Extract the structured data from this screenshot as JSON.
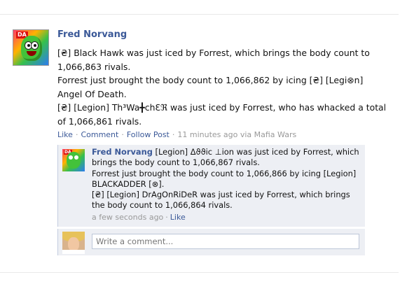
{
  "post": {
    "author": "Fred Norvang",
    "avatar_tag": "DA",
    "lines": [
      "[₴] Black Hawk was just iced by Forrest, which brings the body count to 1,066,863 rivals.",
      "Forrest just brought the body count to 1,066,862 by icing [₴] [Legi⊗n] Angel Of Death.",
      "[₴] [Legion] Th³Wa╋chƐℜ was just iced by Forrest, who has whacked a total of 1,066,861 rivals."
    ],
    "actions": {
      "like": "Like",
      "comment": "Comment",
      "follow": "Follow Post",
      "time": "11 minutes ago via Mafia Wars"
    }
  },
  "comment": {
    "author": "Fred Norvang",
    "avatar_tag": "DA",
    "line1": "[Legion] Δϑϑic ⊥ion was just iced by Forrest, which brings the body count to 1,066,867 rivals.",
    "line2": "Forrest just brought the body count to 1,066,866 by icing [Legion] BLACKADDER [⊗].",
    "line3": "[₴] [Legion] DrAgOnRiDeR was just iced by Forrest, which brings the body count to 1,066,864 rivals.",
    "time": "a few seconds ago",
    "like": "Like"
  },
  "write_comment": {
    "placeholder": "Write a comment..."
  }
}
